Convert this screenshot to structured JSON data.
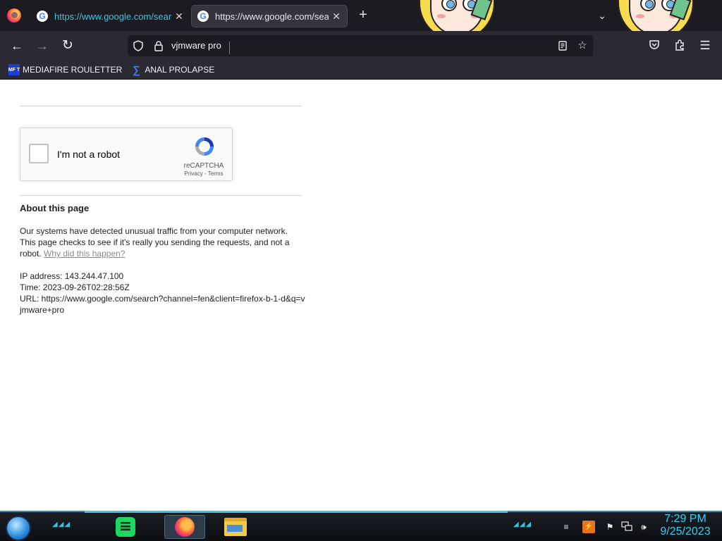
{
  "browser": {
    "tabs": [
      {
        "title": "https://www.google.com/search?channel=fen",
        "active": false
      },
      {
        "title": "https://www.google.com/search?channel=fen",
        "active": true
      }
    ],
    "new_tab_label": "+",
    "address": {
      "value": "vjmware pro"
    },
    "bookmarks": [
      {
        "label": "MEDIAFIRE ROULETTER",
        "icon_text": "MF T",
        "icon": "mediafire-icon"
      },
      {
        "label": "ANAL PROLAPSE",
        "icon": "sigma-icon"
      }
    ]
  },
  "page": {
    "recaptcha": {
      "label": "I'm not a robot",
      "brand": "reCAPTCHA",
      "links": "Privacy - Terms"
    },
    "about_title": "About this page",
    "about_body": "Our systems have detected unusual traffic from your computer network. This page checks to see if it's really you sending the requests, and not a robot.",
    "why_link": "Why did this happen?",
    "ip_line": "IP address: 143.244.47.100",
    "time_line": "Time: 2023-09-26T02:28:56Z",
    "url_line": "URL: https://www.google.com/search?channel=fen&client=firefox-b-1-d&q=vjmware+pro"
  },
  "taskbar": {
    "apps": [
      "spotify-icon",
      "firefox-icon",
      "file-explorer-icon"
    ],
    "clock_time": "7:29 PM",
    "clock_date": "9/25/2023"
  },
  "colors": {
    "chrome_bg": "#2b2a33",
    "tab_accent": "#36c6e0",
    "taskbar_accent": "#2fd2f0"
  }
}
